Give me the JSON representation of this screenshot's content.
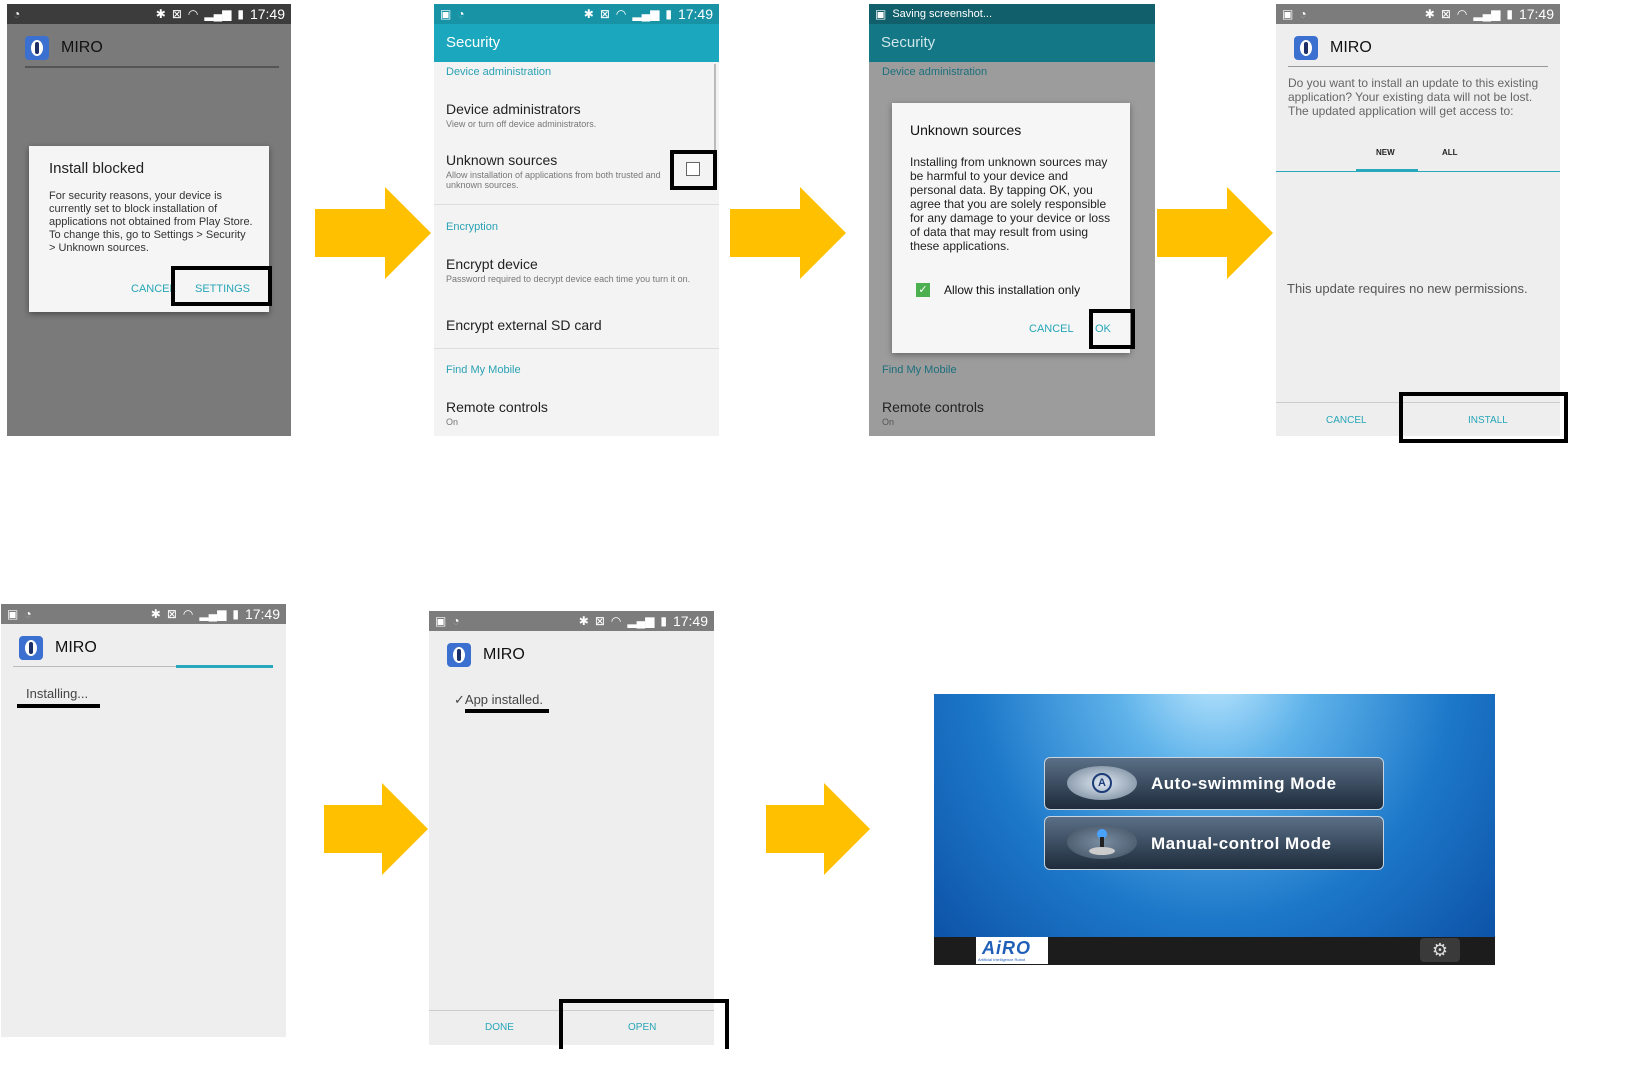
{
  "status_time": "17:49",
  "screen1": {
    "app_name": "MIRO",
    "dialog_title": "Install blocked",
    "dialog_body": "For security reasons, your device is currently set to block installation of applications not obtained from Play Store. To change this, go to Settings > Security > Unknown sources.",
    "cancel_label": "CANCEL",
    "settings_label": "SETTINGS"
  },
  "screen2": {
    "header": "Security",
    "sections": [
      {
        "label": "Device administration"
      },
      {
        "label": "Encryption"
      },
      {
        "label": "Find My Mobile"
      }
    ],
    "items": [
      {
        "title": "Device administrators",
        "sub": "View or turn off device administrators."
      },
      {
        "title": "Unknown sources",
        "sub": "Allow installation of applications from both trusted and unknown sources."
      },
      {
        "title": "Encrypt device",
        "sub": "Password required to decrypt device each time you turn it on."
      },
      {
        "title": "Encrypt external SD card",
        "sub": ""
      },
      {
        "title": "Remote controls",
        "sub": "On"
      }
    ]
  },
  "screen3": {
    "status_text": "Saving screenshot...",
    "header": "Security",
    "section_top": "Device administration",
    "section_bottom": "Find My Mobile",
    "remote_title": "Remote controls",
    "remote_sub": "On",
    "dialog_title": "Unknown sources",
    "dialog_body": "Installing from unknown sources may be harmful to your device and personal data. By tapping OK, you agree that you are solely responsible for any damage to your device or loss of data that may result from using these applications.",
    "checkbox_label": "Allow this installation only",
    "cancel_label": "CANCEL",
    "ok_label": "OK"
  },
  "screen4": {
    "app_name": "MIRO",
    "message": "Do you want to install an update to this existing application? Your existing data will not be lost. The updated application will get access to:",
    "tab_new": "NEW",
    "tab_all": "ALL",
    "no_permissions": "This update requires no new permissions.",
    "cancel_label": "CANCEL",
    "install_label": "INSTALL"
  },
  "screen5": {
    "app_name": "MIRO",
    "status": "Installing..."
  },
  "screen6": {
    "app_name": "MIRO",
    "status": "App installed.",
    "done_label": "DONE",
    "open_label": "OPEN"
  },
  "screen7": {
    "auto_mode_label": "Auto-swimming Mode",
    "manual_mode_label": "Manual-control Mode",
    "logo_text": "AiRO",
    "logo_sub": "Artificial Intelligence Robot"
  },
  "colors": {
    "arrow": "#ffc000",
    "teal": "#26a6b8",
    "header_teal": "#1ba7bd",
    "ocean": "#1f78c8"
  }
}
